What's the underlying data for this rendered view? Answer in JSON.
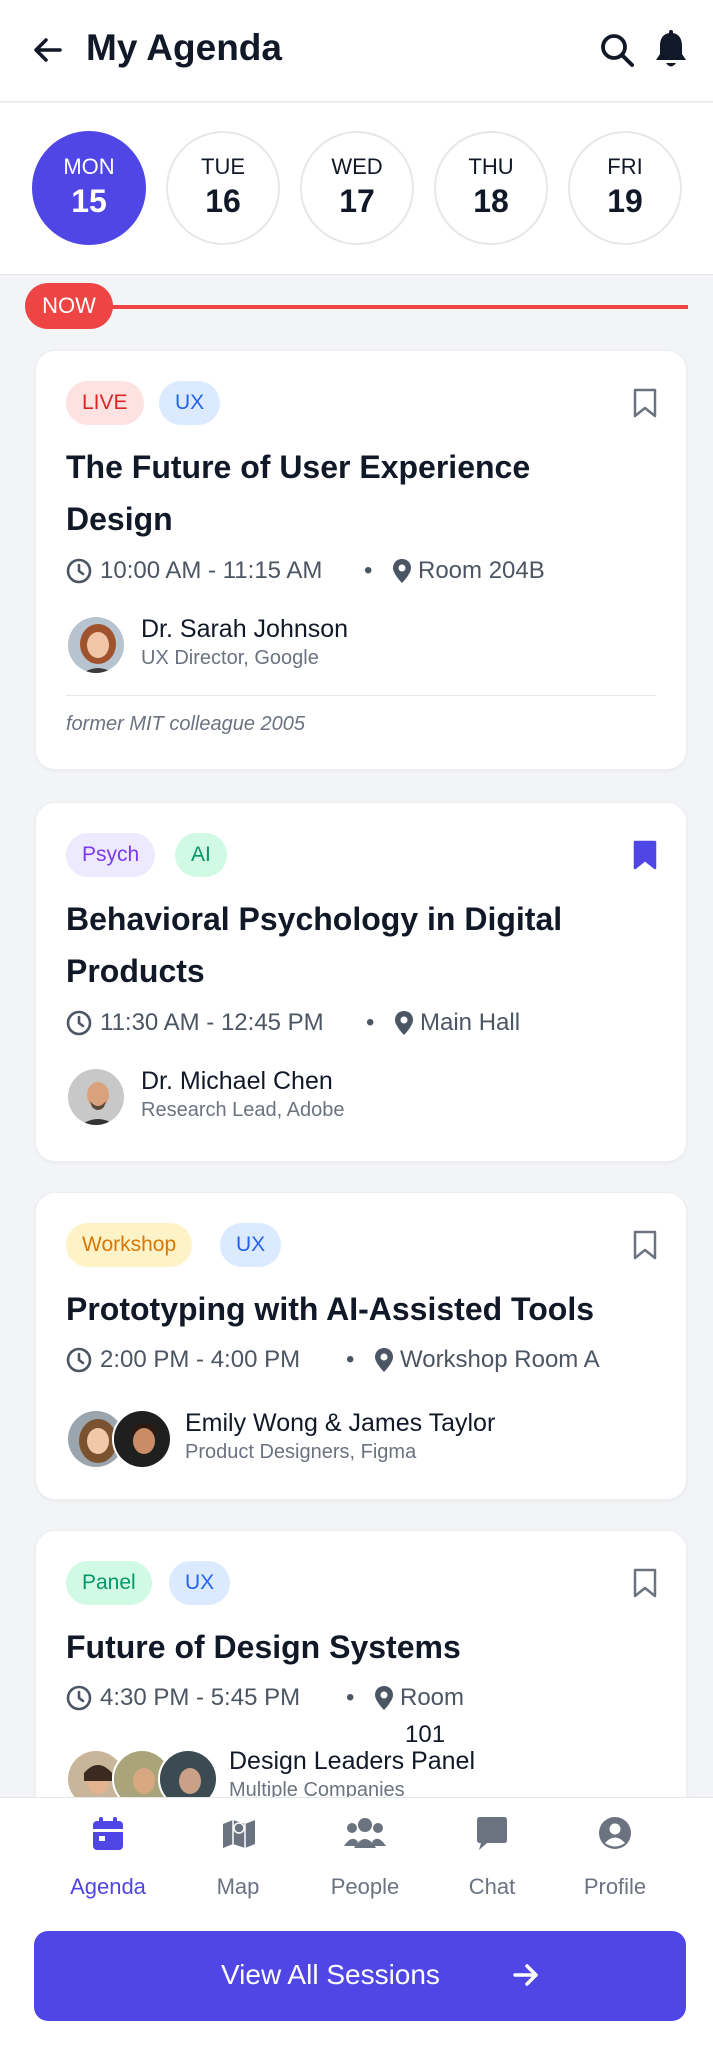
{
  "header": {
    "title": "My Agenda"
  },
  "days": [
    {
      "name": "MON",
      "num": "15",
      "active": true
    },
    {
      "name": "TUE",
      "num": "16"
    },
    {
      "name": "WED",
      "num": "17"
    },
    {
      "name": "THU",
      "num": "18"
    },
    {
      "name": "FRI",
      "num": "19"
    }
  ],
  "now_label": "NOW",
  "sessions": [
    {
      "tags": [
        "LIVE",
        "UX"
      ],
      "bookmarked": false,
      "title": "The Future of User Experience Design",
      "time": "10:00 AM - 11:15 AM",
      "location": "Room 204B",
      "speaker": "Dr. Sarah Johnson",
      "role": "UX Director, Google",
      "note": "former MIT colleague 2005"
    },
    {
      "tags": [
        "Psych",
        "AI"
      ],
      "bookmarked": true,
      "title": "Behavioral Psychology in Digital Products",
      "time": "11:30 AM - 12:45 PM",
      "location": "Main Hall",
      "speaker": "Dr. Michael Chen",
      "role": "Research Lead, Adobe"
    },
    {
      "tags": [
        "Workshop",
        "UX"
      ],
      "bookmarked": false,
      "title": "Prototyping with AI-Assisted Tools",
      "time": "2:00 PM - 4:00 PM",
      "location": "Workshop Room A",
      "speaker": "Emily Wong & James Taylor",
      "role": "Product Designers, Figma"
    },
    {
      "tags": [
        "Panel",
        "UX"
      ],
      "bookmarked": false,
      "title": "Future of Design Systems",
      "time": "4:30 PM - 5:45 PM",
      "location": "Room",
      "location_extra": "101",
      "speaker": "Design Leaders Panel",
      "role": "Multiple Companies"
    }
  ],
  "nav": [
    {
      "label": "Agenda",
      "icon": "calendar-icon",
      "active": true
    },
    {
      "label": "Map",
      "icon": "map-icon"
    },
    {
      "label": "People",
      "icon": "people-icon"
    },
    {
      "label": "Chat",
      "icon": "chat-icon"
    },
    {
      "label": "Profile",
      "icon": "profile-icon"
    }
  ],
  "cta": {
    "label": "View All Sessions"
  },
  "colors": {
    "accent": "#4f46e5",
    "live": "#ef4444",
    "text": "#111827",
    "muted": "#6b7280"
  }
}
